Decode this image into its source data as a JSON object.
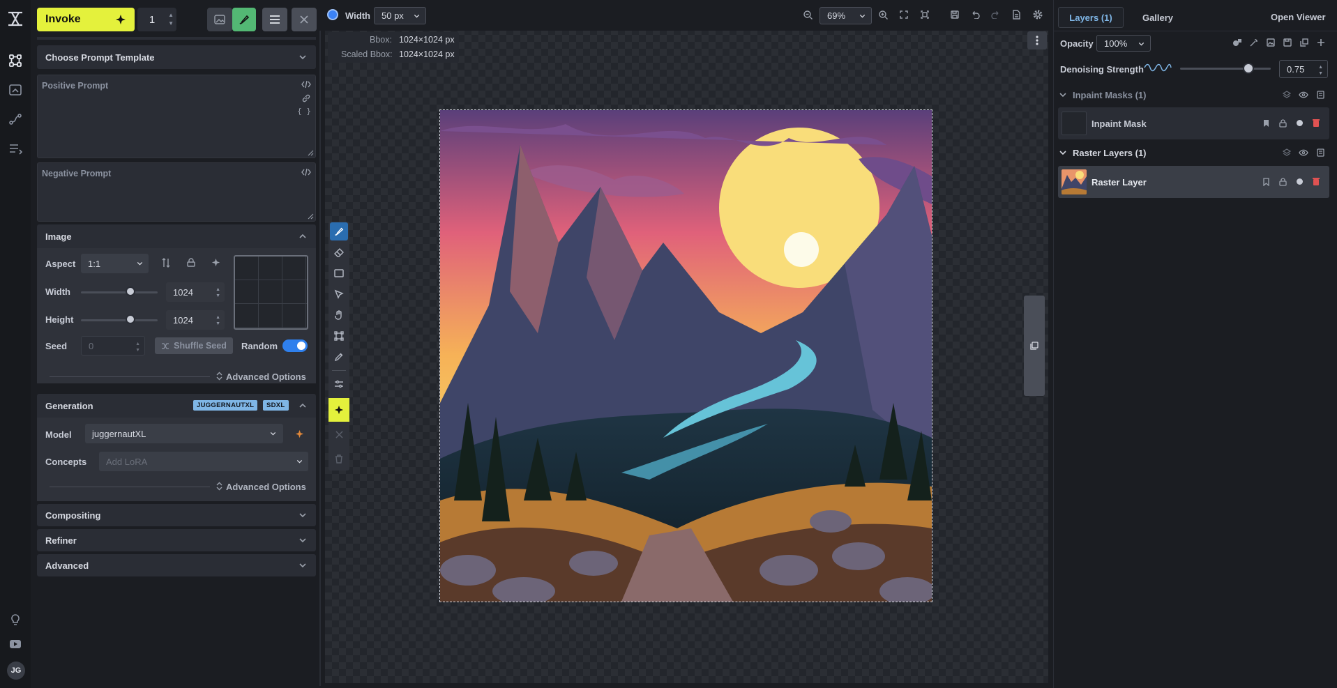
{
  "nav": {
    "items": [
      "logo-icon",
      "canvas-icon",
      "upscale-icon",
      "workflows-icon",
      "queue-icon"
    ],
    "bottom": [
      "lightbulb-icon",
      "youtube-icon"
    ],
    "avatar": "JG"
  },
  "toolbar": {
    "invoke_label": "Invoke",
    "iterations": "1"
  },
  "left_panel": {
    "prompt_template": "Choose Prompt Template",
    "positive_placeholder": "Positive Prompt",
    "negative_placeholder": "Negative Prompt",
    "image": {
      "title": "Image",
      "aspect_label": "Aspect",
      "aspect_value": "1:1",
      "width_label": "Width",
      "width_value": "1024",
      "width_fraction": 0.65,
      "height_label": "Height",
      "height_value": "1024",
      "height_fraction": 0.65,
      "seed_label": "Seed",
      "seed_value": "0",
      "shuffle_label": "Shuffle Seed",
      "random_label": "Random",
      "random_on": true,
      "advanced": "Advanced Options"
    },
    "generation": {
      "title": "Generation",
      "badges": [
        "JUGGERNAUTXL",
        "SDXL"
      ],
      "model_label": "Model",
      "model_value": "juggernautXL",
      "concepts_label": "Concepts",
      "concepts_placeholder": "Add LoRA",
      "advanced": "Advanced Options"
    },
    "collapsed": [
      "Compositing",
      "Refiner",
      "Advanced"
    ]
  },
  "canvas_bar": {
    "brush_width_label": "Width",
    "brush_width_value": "50 px",
    "zoom": "69%"
  },
  "canvas": {
    "bbox_label": "Bbox:",
    "bbox_value": "1024×1024 px",
    "scaled_label": "Scaled Bbox:",
    "scaled_value": "1024×1024 px"
  },
  "right_panel": {
    "tabs": [
      "Layers (1)",
      "Gallery"
    ],
    "open_viewer": "Open Viewer",
    "opacity_label": "Opacity",
    "opacity_value": "100%",
    "denoise_label": "Denoising Strength",
    "denoise_value": "0.75",
    "denoise_fraction": 0.75,
    "inpaint_group": "Inpaint Masks (1)",
    "inpaint_layer": "Inpaint Mask",
    "raster_group": "Raster Layers (1)",
    "raster_layer": "Raster Layer"
  },
  "colors": {
    "accent": "#e4f13c",
    "brush": "#3b82f6",
    "badge": "#7fb6e6",
    "delete": "#e05252"
  }
}
